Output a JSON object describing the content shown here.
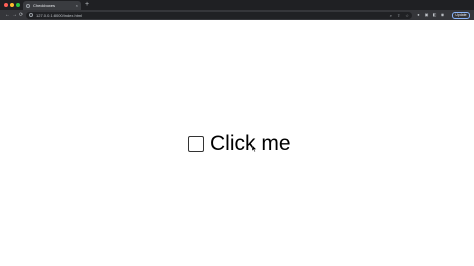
{
  "browser": {
    "tab": {
      "title": "Checkboxes",
      "close_glyph": "×",
      "icon": "globe-icon"
    },
    "new_tab_glyph": "+",
    "nav": {
      "back_glyph": "←",
      "forward_glyph": "→",
      "reload_glyph": "⟳"
    },
    "address_bar": {
      "url": "127.0.0.1:8000/index.html"
    },
    "omnibox_icons": [
      "zoom-icon",
      "share-icon",
      "bookmark-star-icon"
    ],
    "extension_icons": [
      "extension-icon",
      "puzzle-icon",
      "sidebar-icon",
      "profile-icon"
    ],
    "update_button": "Update"
  },
  "page": {
    "checkbox": {
      "label": "Click me",
      "checked": false
    }
  },
  "colors": {
    "titlebar": "#1f2023",
    "toolbar": "#35363a",
    "page_background": "#ffffff",
    "text": "#000000"
  }
}
